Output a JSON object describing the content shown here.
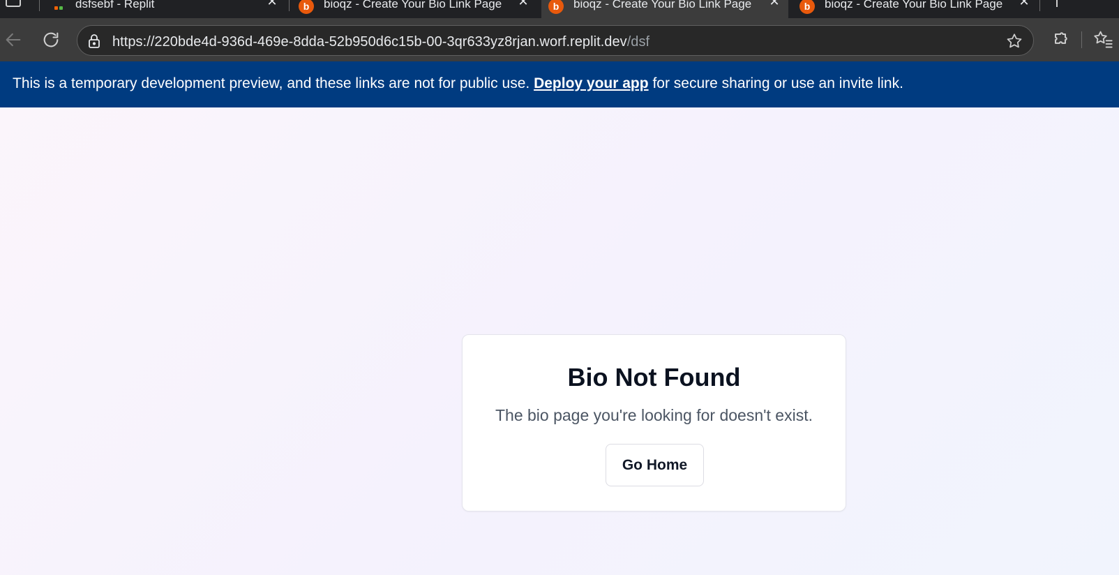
{
  "browser": {
    "tabs": [
      {
        "title": "dsfsebf - Replit",
        "favicon": "replit-icon",
        "active": false
      },
      {
        "title": "bioqz - Create Your Bio Link Page",
        "favicon": "b",
        "active": false
      },
      {
        "title": "bioqz - Create Your Bio Link Page",
        "favicon": "b",
        "active": true
      },
      {
        "title": "bioqz - Create Your Bio Link Page",
        "favicon": "b",
        "active": false
      }
    ],
    "url_main": "https://220bde4d-936d-469e-8dda-52b950d6c15b-00-3qr633yz8rjan.worf.replit.dev",
    "url_path": "/dsf"
  },
  "banner": {
    "text_before": "This is a temporary development preview, and these links are not for public use.",
    "link_label": "Deploy your app",
    "text_after": "for secure sharing or use an invite link."
  },
  "card": {
    "title": "Bio Not Found",
    "message": "The bio page you're looking for doesn't exist.",
    "button_label": "Go Home"
  },
  "colors": {
    "banner_bg": "#003b80",
    "favicon_orange": "#e8590c",
    "browser_toolbar": "#3c3c3c"
  }
}
